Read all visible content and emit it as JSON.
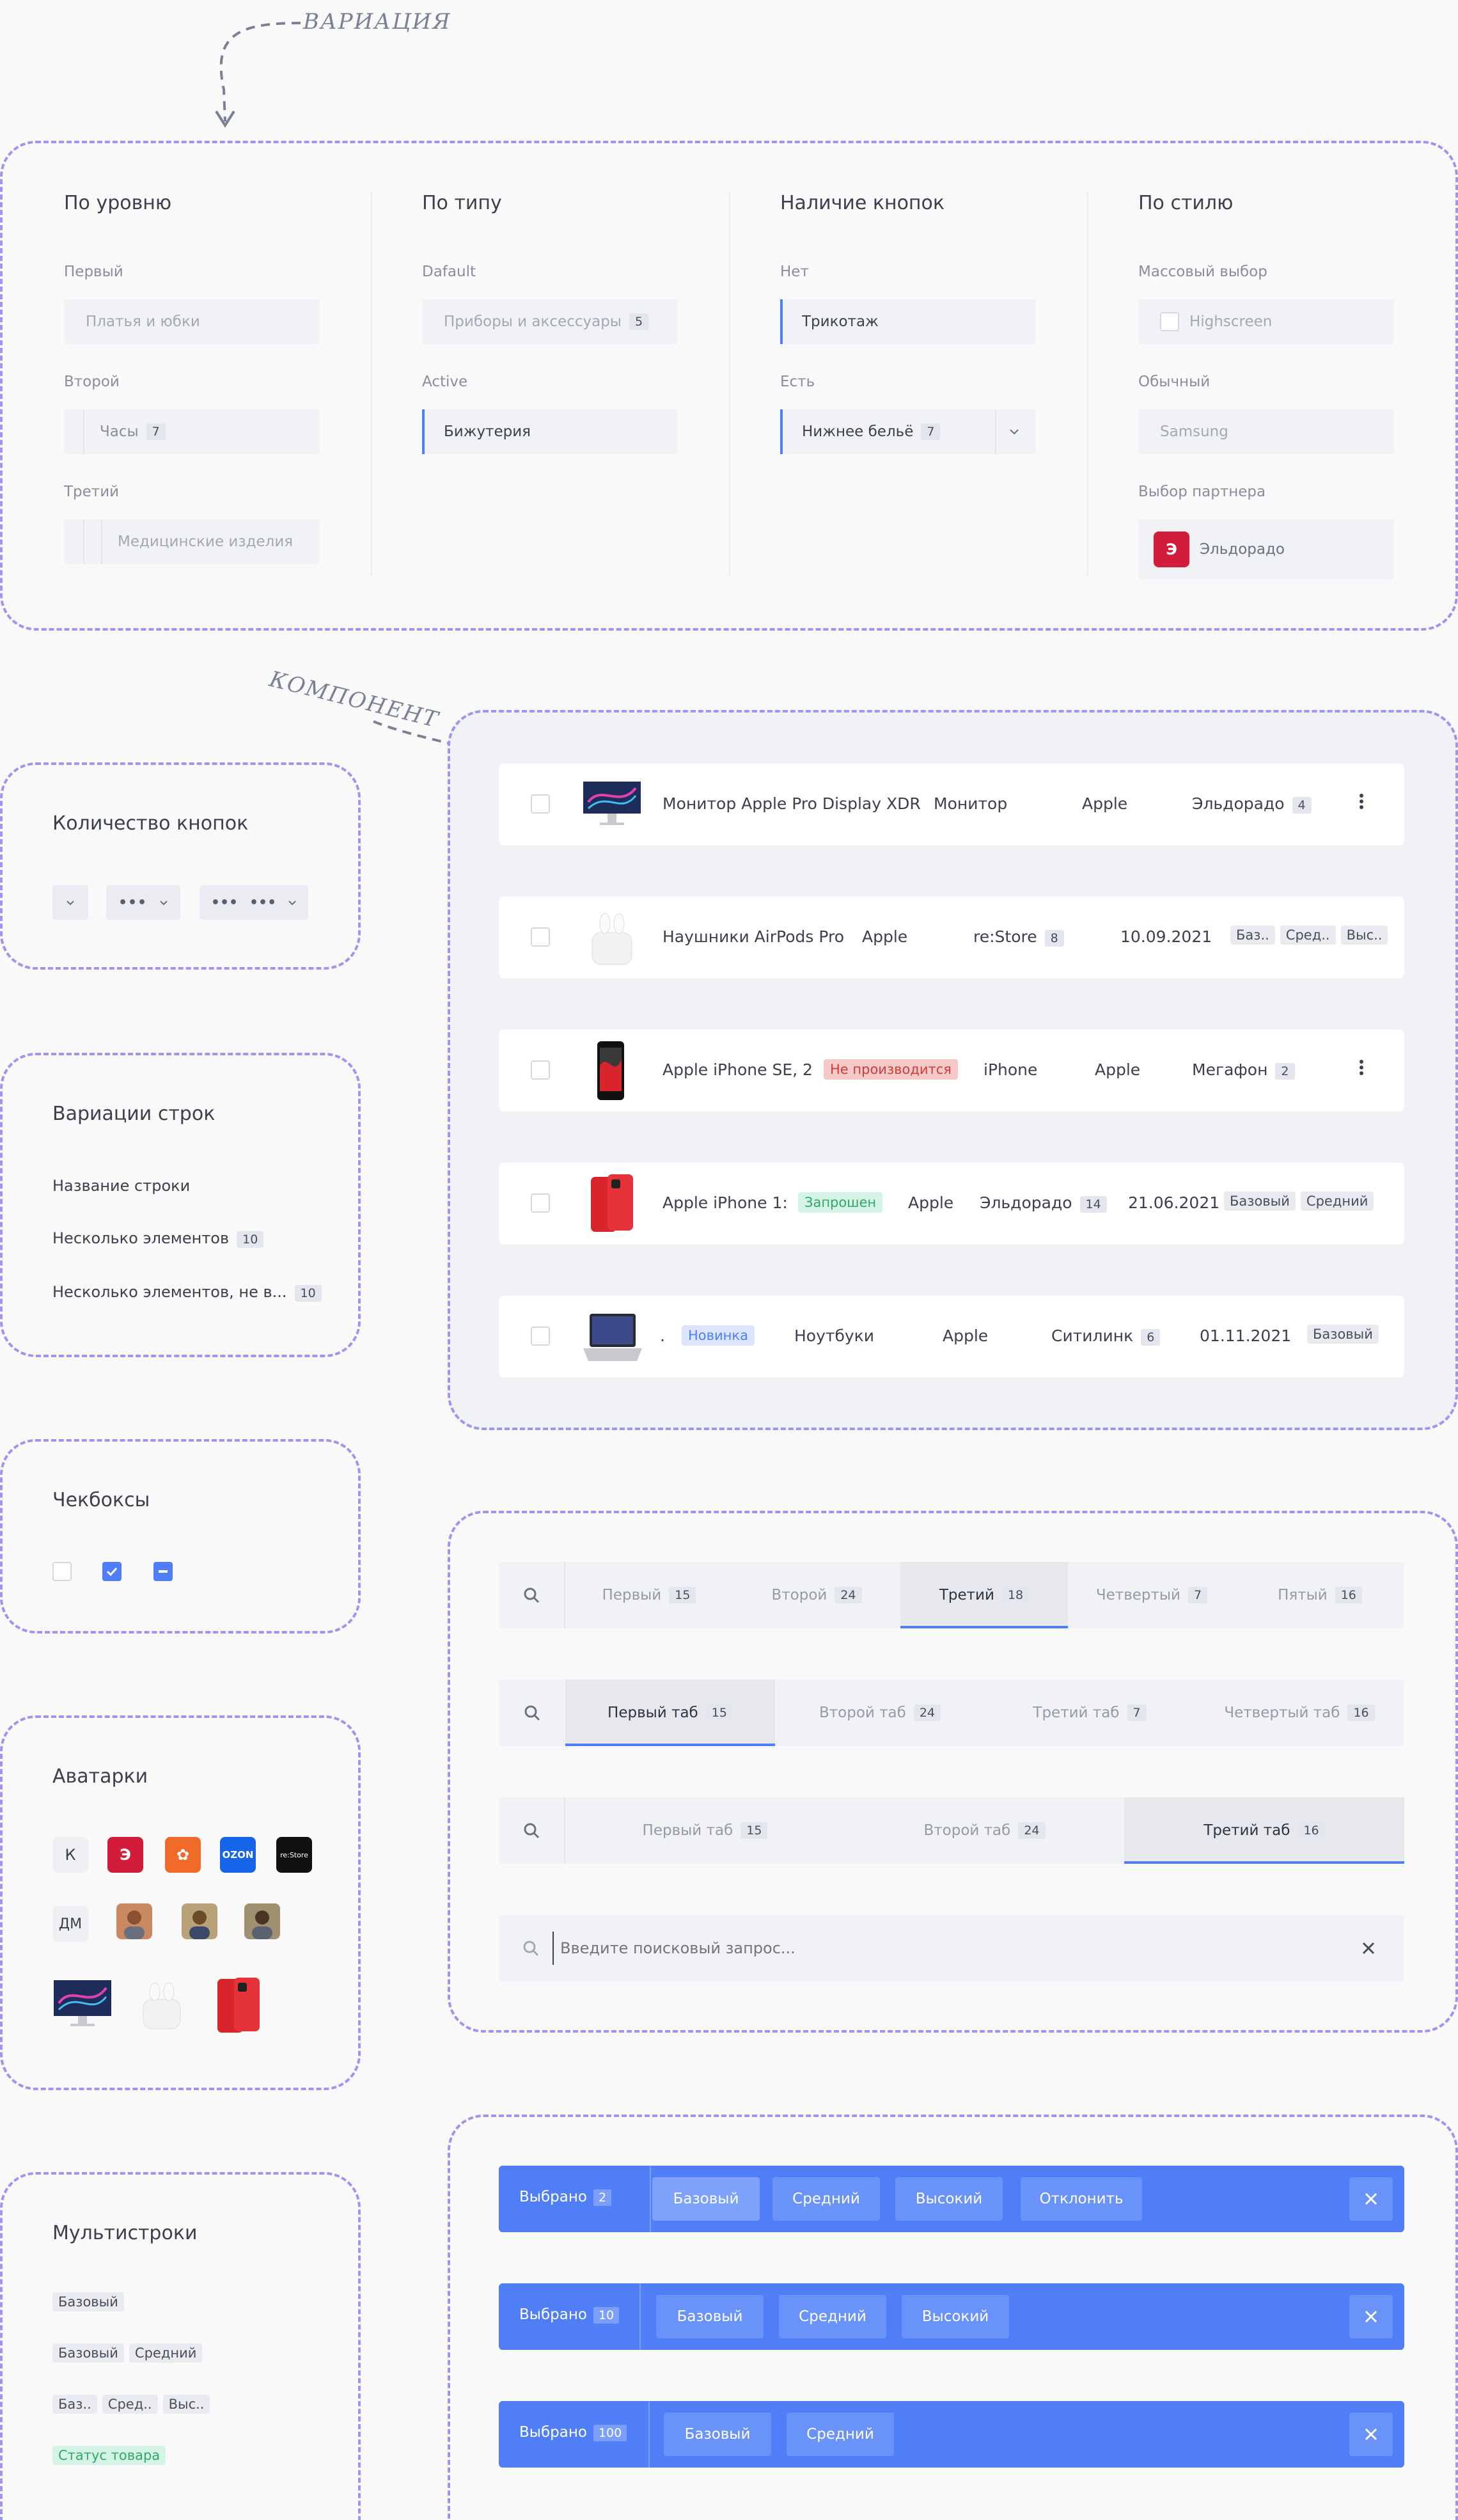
{
  "annotations": {
    "variation": "ВАРИАЦИЯ",
    "component": "КОМПОНЕНТ"
  },
  "variants": {
    "col1": {
      "title": "По уровню",
      "l1": "Первый",
      "f1": "Платья и юбки",
      "l2": "Второй",
      "f2": "Часы",
      "c2": "7",
      "l3": "Третий",
      "f3": "Медицинские изделия"
    },
    "col2": {
      "title": "По типу",
      "l1": "Dafault",
      "f1": "Приборы и аксессуары",
      "c1": "5",
      "l2": "Active",
      "f2": "Бижутерия"
    },
    "col3": {
      "title": "Наличие кнопок",
      "l1": "Нет",
      "f1": "Трикотаж",
      "l2": "Есть",
      "f2": "Нижнее бельё",
      "c2": "7"
    },
    "col4": {
      "title": "По стилю",
      "l1": "Массовый выбор",
      "f1": "Highscreen",
      "l2": "Обычный",
      "f2": "Samsung",
      "l3": "Выбор партнера",
      "f3": "Эльдорадо"
    }
  },
  "buttons_count": {
    "title": "Количество кнопок"
  },
  "row_variations": {
    "title": "Вариации строк",
    "r1": "Название строки",
    "r2": "Несколько элементов",
    "r2c": "10",
    "r3": "Несколько элементов, не в...",
    "r3c": "10"
  },
  "checkboxes": {
    "title": "Чекбоксы"
  },
  "avatars": {
    "title": "Аватарки",
    "k": "К",
    "dm": "ДМ",
    "ozon": "OZON",
    "restore": "re:Store"
  },
  "multilines": {
    "title": "Мультистроки",
    "t1": "Базовый",
    "t2a": "Базовый",
    "t2b": "Средний",
    "t3a": "Баз..",
    "t3b": "Сред..",
    "t3c": "Выс..",
    "t4": "Статус товара"
  },
  "rows": [
    {
      "name": "Монитор Apple Pro Display XDR",
      "category": "Монитор",
      "brand": "Apple",
      "partner": "Эльдорадо",
      "count": "4"
    },
    {
      "name": "Наушники AirPods Pro",
      "brand": "Apple",
      "partner": "re:Store",
      "count": "8",
      "date": "10.09.2021",
      "tags": [
        "Баз..",
        "Сред..",
        "Выс.."
      ]
    },
    {
      "name": "Apple iPhone SE, 2",
      "status": "Не производится",
      "category": "iPhone",
      "brand": "Apple",
      "partner": "Мегафон",
      "count": "2"
    },
    {
      "name": "Apple iPhone 1:",
      "status": "Запрошен",
      "brand": "Apple",
      "partner": "Эльдорадо",
      "count": "14",
      "date": "21.06.2021",
      "tags": [
        "Базовый",
        "Средний"
      ]
    },
    {
      "name": ".",
      "status": "Новинка",
      "category": "Ноутбуки",
      "brand": "Apple",
      "partner": "Ситилинк",
      "count": "6",
      "date": "01.11.2021",
      "tags": [
        "Базовый"
      ]
    }
  ],
  "tabs1": [
    {
      "label": "Первый",
      "count": "15"
    },
    {
      "label": "Второй",
      "count": "24"
    },
    {
      "label": "Третий",
      "count": "18"
    },
    {
      "label": "Четвертый",
      "count": "7"
    },
    {
      "label": "Пятый",
      "count": "16"
    }
  ],
  "tabs2": [
    {
      "label": "Первый таб",
      "count": "15"
    },
    {
      "label": "Второй таб",
      "count": "24"
    },
    {
      "label": "Третий таб",
      "count": "7"
    },
    {
      "label": "Четвертый таб",
      "count": "16"
    }
  ],
  "tabs3": [
    {
      "label": "Первый таб",
      "count": "15"
    },
    {
      "label": "Второй таб",
      "count": "24"
    },
    {
      "label": "Третий таб",
      "count": "16"
    }
  ],
  "search": {
    "placeholder": "Введите поисковый запрос..."
  },
  "selection": [
    {
      "label": "Выбрано",
      "count": "2",
      "buttons": [
        "Базовый",
        "Средний",
        "Высокий",
        "Отклонить"
      ]
    },
    {
      "label": "Выбрано",
      "count": "10",
      "buttons": [
        "Базовый",
        "Средний",
        "Высокий"
      ]
    },
    {
      "label": "Выбрано",
      "count": "100",
      "buttons": [
        "Базовый",
        "Средний"
      ]
    }
  ],
  "colors": {
    "accent": "#4f7ef7",
    "dashed": "#9b97ee",
    "eldorado": "#d21c3c",
    "status_red": "#f6c9c9",
    "status_green": "#d6f4e6",
    "status_blue": "#dbe6fd"
  }
}
